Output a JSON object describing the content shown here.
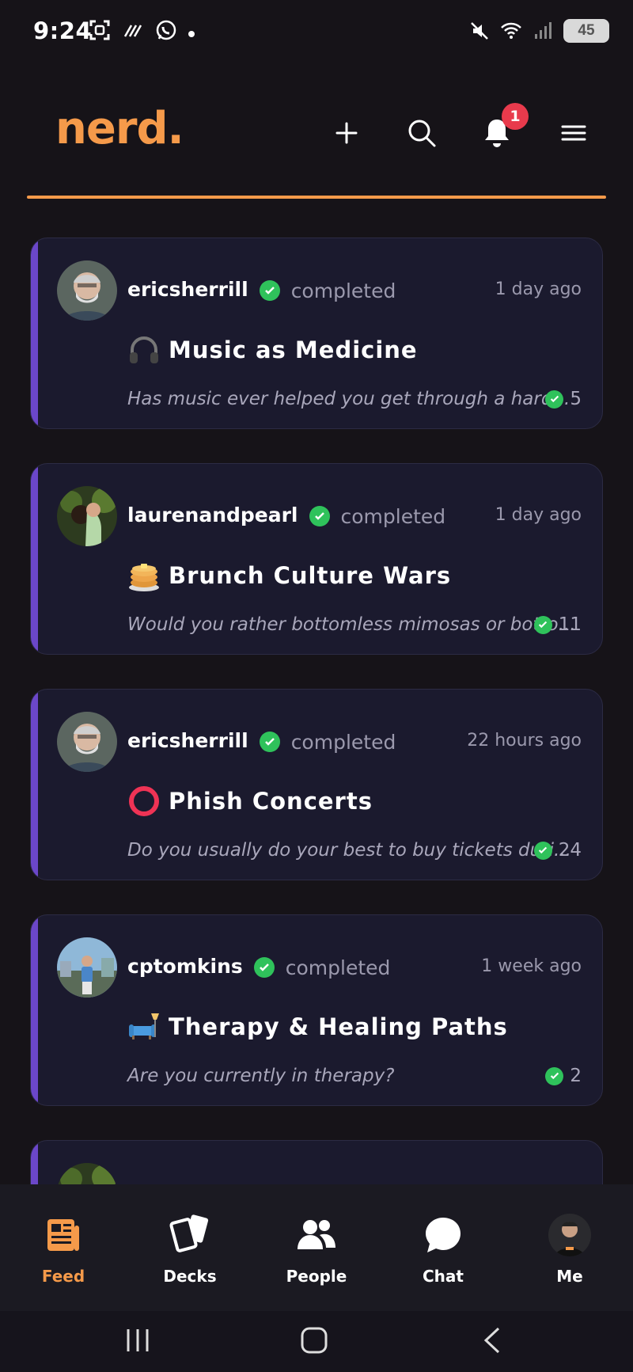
{
  "status_bar": {
    "time": "9:24",
    "battery": "45"
  },
  "header": {
    "logo": "nerd.",
    "notification_count": "1"
  },
  "feed": {
    "items": [
      {
        "username": "ericsherrill",
        "status": "completed",
        "time": "1 day ago",
        "emoji": "headphones",
        "title": "Music as Medicine",
        "snippet": "Has music ever helped you get through a hard...",
        "count": "5"
      },
      {
        "username": "laurenandpearl",
        "status": "completed",
        "time": "1 day ago",
        "emoji": "pancakes",
        "title": "Brunch Culture Wars",
        "snippet": "Would you rather bottomless mimosas or botto...",
        "count": "11"
      },
      {
        "username": "ericsherrill",
        "status": "completed",
        "time": "22 hours ago",
        "emoji": "red-circle",
        "title": "Phish Concerts",
        "snippet": "Do you usually do your best to buy tickets duri...",
        "count": "24"
      },
      {
        "username": "cptomkins",
        "status": "completed",
        "time": "1 week ago",
        "emoji": "couch-lamp",
        "title": "Therapy & Healing Paths",
        "snippet": "Are you currently in therapy?",
        "count": "2"
      }
    ]
  },
  "bottom_nav": {
    "items": [
      {
        "label": "Feed",
        "icon": "feed-icon",
        "active": true
      },
      {
        "label": "Decks",
        "icon": "decks-icon",
        "active": false
      },
      {
        "label": "People",
        "icon": "people-icon",
        "active": false
      },
      {
        "label": "Chat",
        "icon": "chat-icon",
        "active": false
      },
      {
        "label": "Me",
        "icon": "me-avatar",
        "active": false
      }
    ]
  },
  "colors": {
    "accent": "#f59a4a",
    "card_bg": "#1b1a2e",
    "card_stripe": "#6b47c9",
    "check": "#2fc25b",
    "badge": "#e83a4c"
  }
}
